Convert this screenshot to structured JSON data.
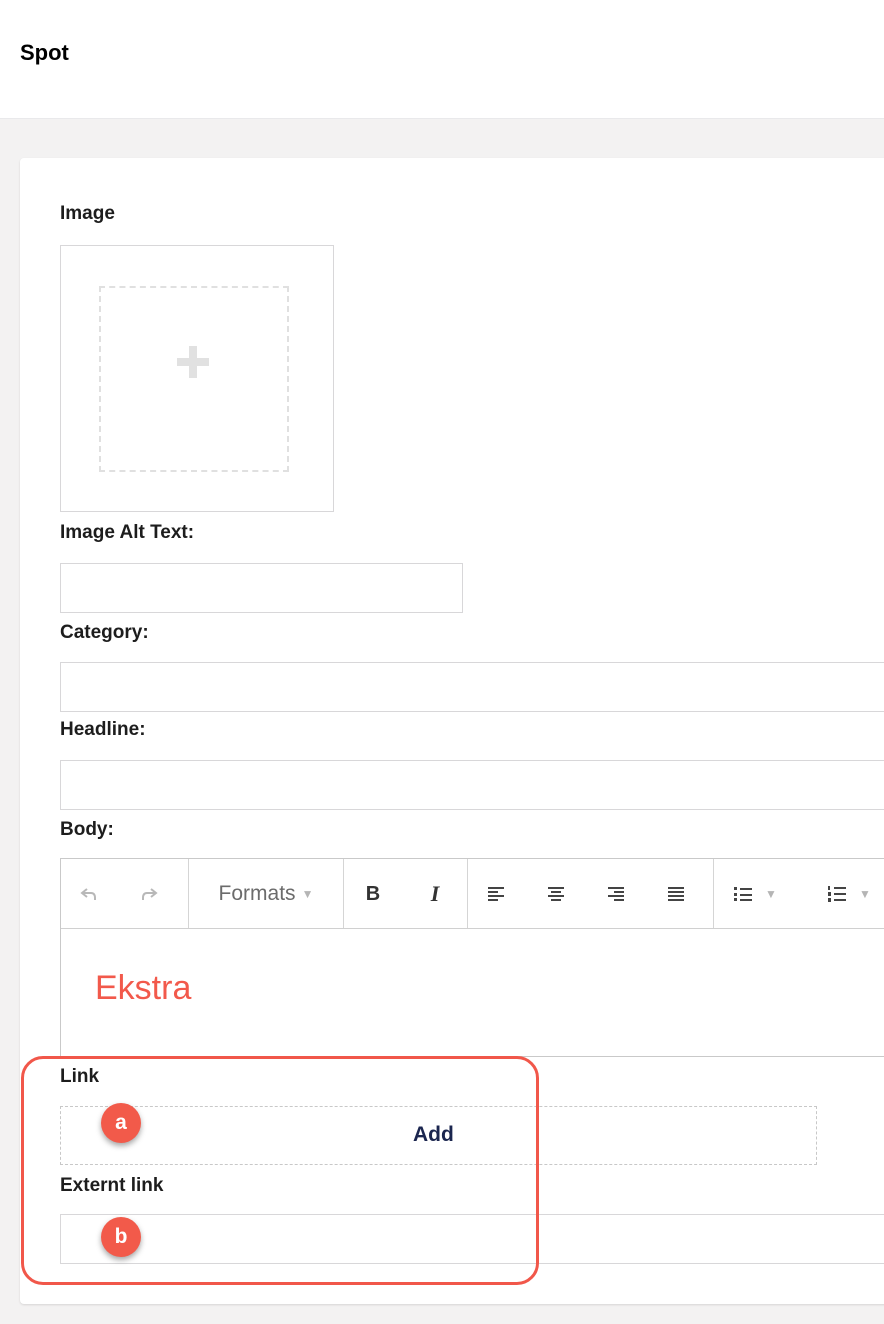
{
  "header": {
    "title": "Spot"
  },
  "form": {
    "image_label": "Image",
    "image_alt_label": "Image Alt Text:",
    "image_alt_value": "",
    "category_label": "Category:",
    "category_value": "",
    "headline_label": "Headline:",
    "headline_value": "",
    "body_label": "Body:",
    "link_label": "Link",
    "link_add_label": "Add",
    "external_link_label": "Externt link",
    "external_link_value": ""
  },
  "editor": {
    "toolbar": {
      "formats_label": "Formats",
      "bold_label": "B",
      "italic_label": "I",
      "icons": [
        "undo-icon",
        "redo-icon",
        "align-left-icon",
        "align-center-icon",
        "align-right-icon",
        "align-justify-icon",
        "bullet-list-icon",
        "numbered-list-icon"
      ]
    },
    "content": "Ekstra"
  },
  "annotations": {
    "a": "a",
    "b": "b"
  },
  "colors": {
    "accent": "#f1574a",
    "text_dark": "#1b264f",
    "content_text": "#f2594b"
  }
}
